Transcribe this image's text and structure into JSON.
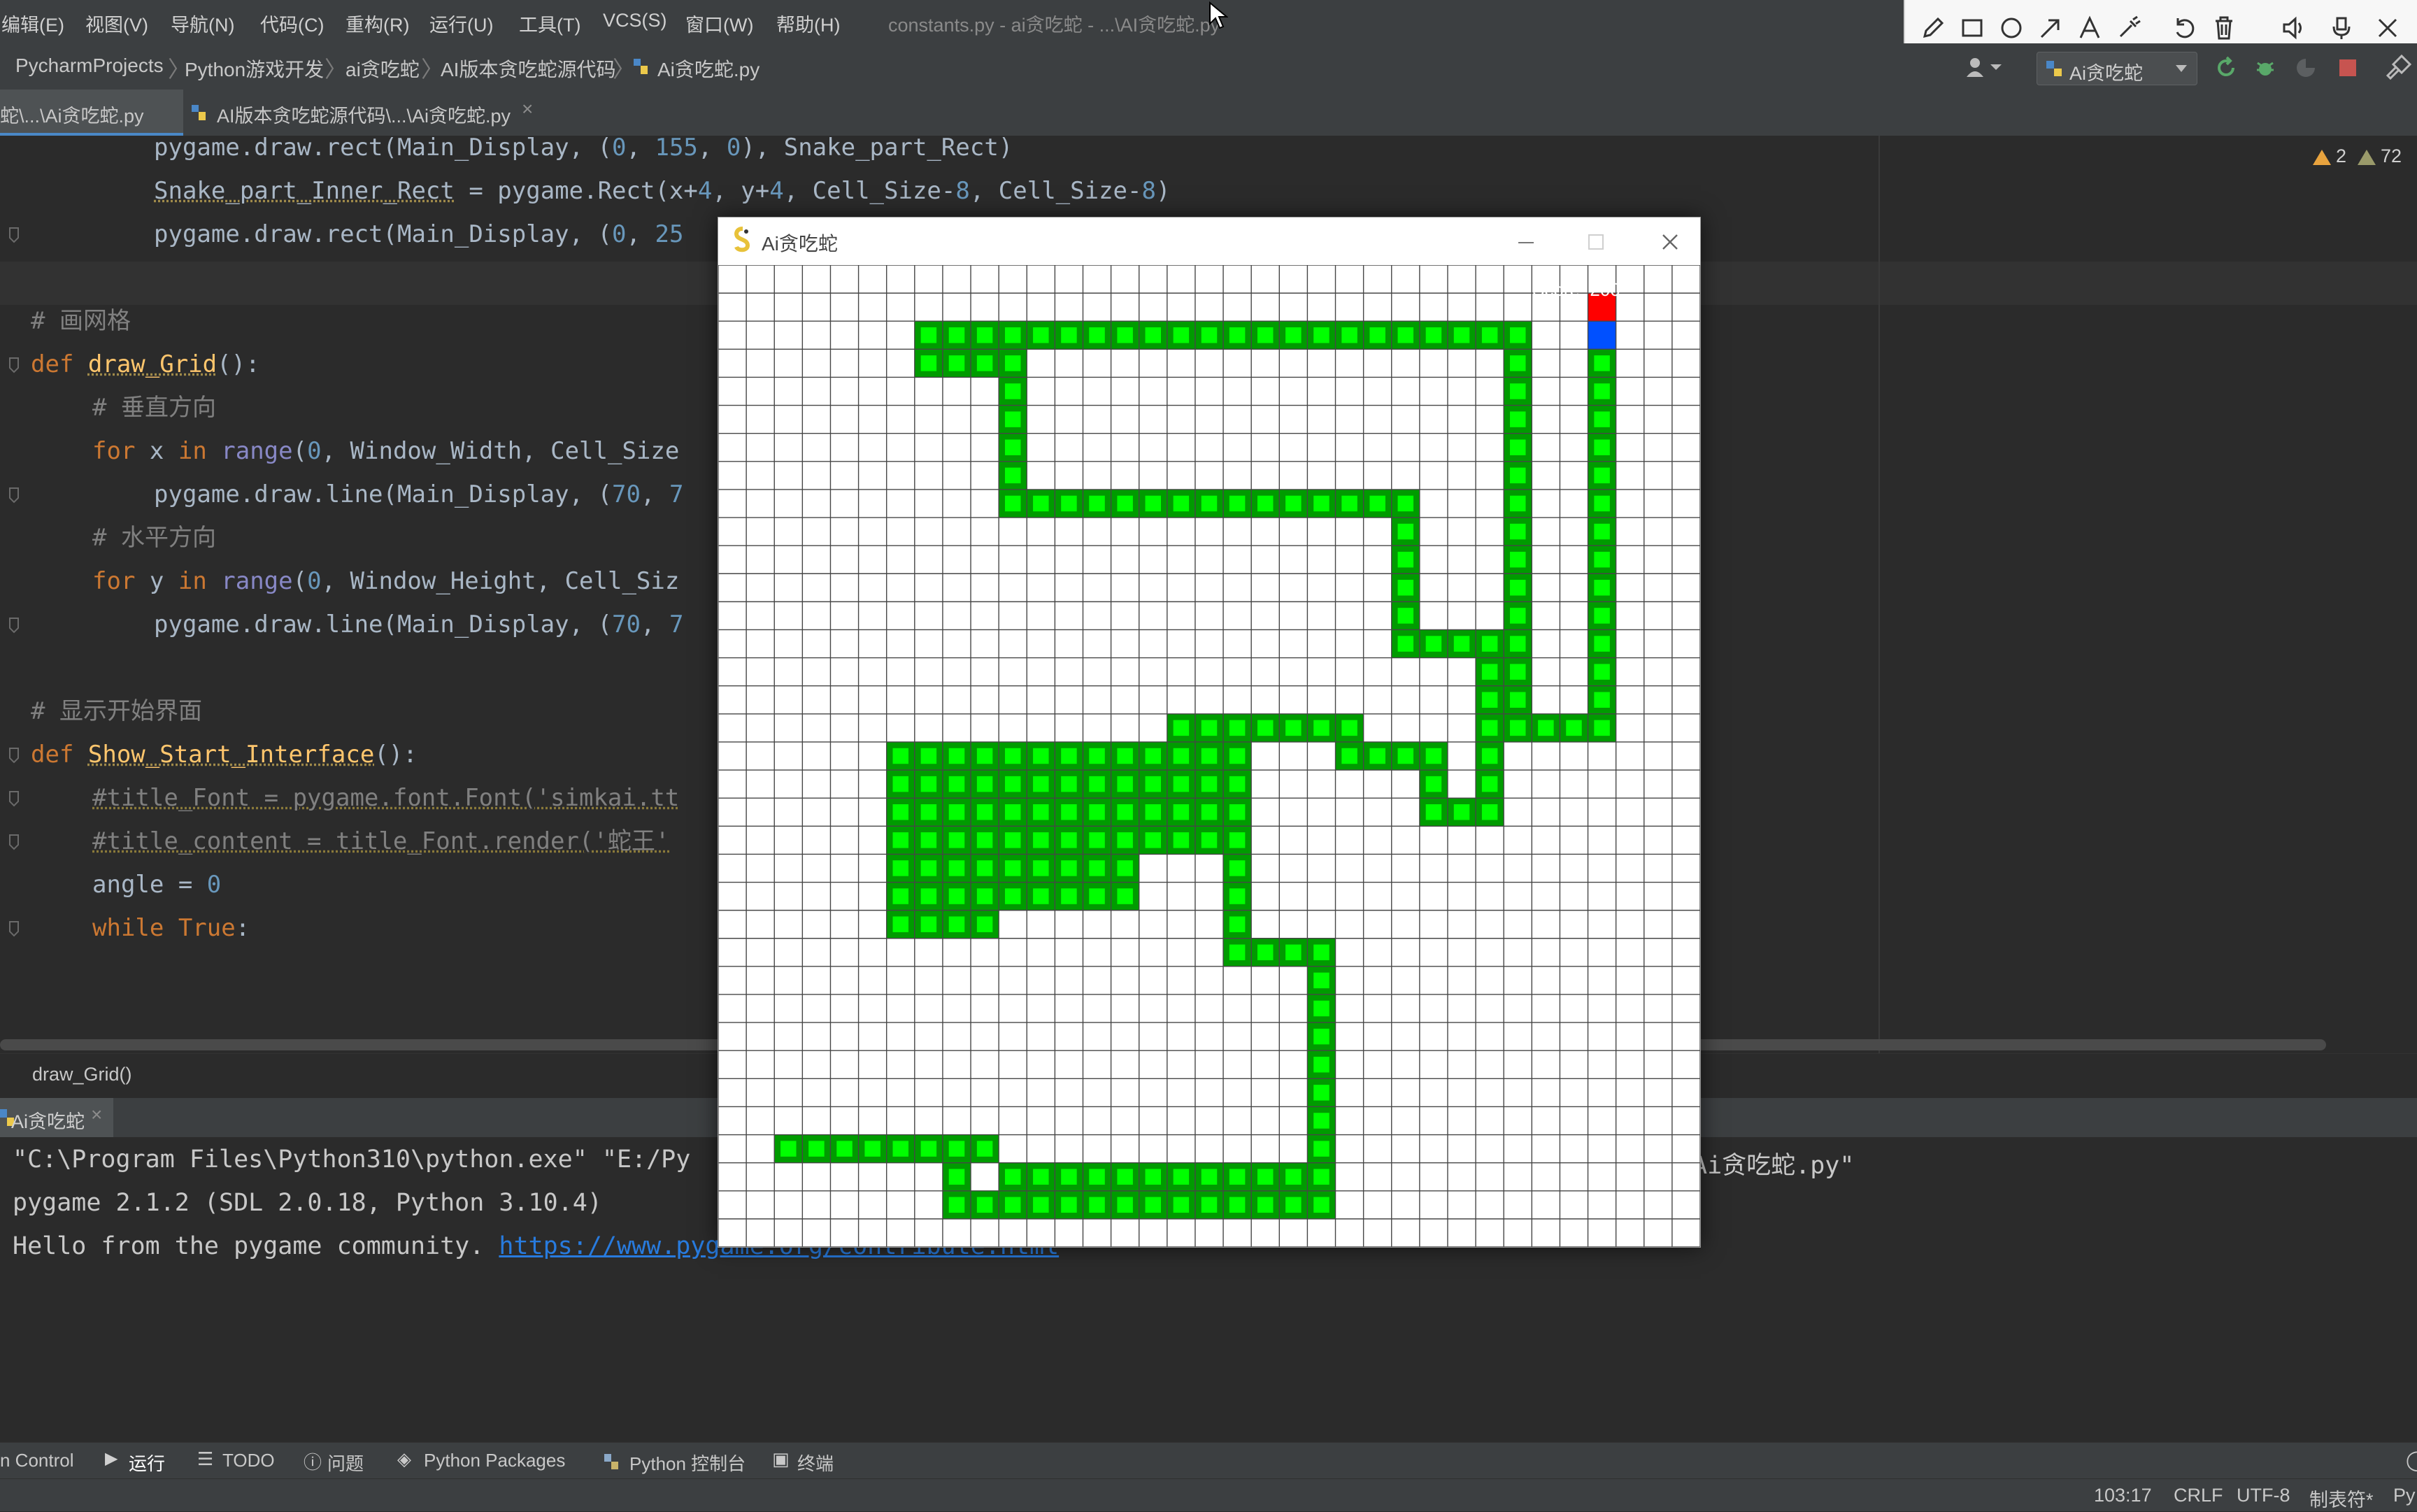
{
  "menubar": {
    "items": [
      "编辑(E)",
      "视图(V)",
      "导航(N)",
      "代码(C)",
      "重构(R)",
      "运行(U)",
      "工具(T)",
      "VCS(S)",
      "窗口(W)",
      "帮助(H)"
    ],
    "window_title": "constants.py - ai贪吃蛇 - ...\\AI贪吃蛇.py"
  },
  "navbar": {
    "crumbs": [
      "PycharmProjects",
      "Python游戏开发",
      "ai贪吃蛇",
      "AI版本贪吃蛇源代码",
      "Ai贪吃蛇.py"
    ],
    "run_config": "Ai贪吃蛇"
  },
  "tabs": [
    {
      "label": "蛇\\...\\Ai贪吃蛇.py",
      "active": true
    },
    {
      "label": "AI版本贪吃蛇源代码\\...\\Ai贪吃蛇.py",
      "active": false
    }
  ],
  "inspection": {
    "warnings": "2",
    "weak_warnings": "72"
  },
  "code": [
    {
      "indent": 2,
      "tokens": [
        [
          "pygame.draw.rect(Main_Display, (",
          "p"
        ],
        [
          "0",
          "n"
        ],
        [
          ", ",
          "p"
        ],
        [
          "155",
          "n"
        ],
        [
          ", ",
          "p"
        ],
        [
          "0",
          "n"
        ],
        [
          "), Snake_part_Rect)",
          "p"
        ]
      ]
    },
    {
      "indent": 2,
      "tokens": [
        [
          "Snake_part_Inner_Rect",
          "u"
        ],
        [
          " = pygame.Rect(x+",
          "p"
        ],
        [
          "4",
          "n"
        ],
        [
          ", y+",
          "p"
        ],
        [
          "4",
          "n"
        ],
        [
          ", Cell_Size-",
          "p"
        ],
        [
          "8",
          "n"
        ],
        [
          ", Cell_Size-",
          "p"
        ],
        [
          "8",
          "n"
        ],
        [
          ")",
          "p"
        ]
      ]
    },
    {
      "indent": 2,
      "tokens": [
        [
          "pygame.draw.rect(Main_Display, (",
          "p"
        ],
        [
          "0",
          "n"
        ],
        [
          ", ",
          "p"
        ],
        [
          "25",
          "n"
        ]
      ]
    },
    {
      "indent": 0,
      "tokens": []
    },
    {
      "indent": 0,
      "tokens": [
        [
          "# 画网格",
          "c"
        ]
      ]
    },
    {
      "indent": 0,
      "tokens": [
        [
          "def ",
          "k"
        ],
        [
          "draw_Grid",
          "fu"
        ],
        [
          "():",
          "p"
        ]
      ]
    },
    {
      "indent": 1,
      "tokens": [
        [
          "# 垂直方向",
          "c"
        ]
      ]
    },
    {
      "indent": 1,
      "tokens": [
        [
          "for ",
          "k"
        ],
        [
          "x ",
          "p"
        ],
        [
          "in ",
          "k"
        ],
        [
          "range",
          "b"
        ],
        [
          "(",
          "p"
        ],
        [
          "0",
          "n"
        ],
        [
          ", Window_Width, Cell_Size",
          "p"
        ]
      ]
    },
    {
      "indent": 2,
      "tokens": [
        [
          "pygame.draw.line(Main_Display, (",
          "p"
        ],
        [
          "70",
          "n"
        ],
        [
          ", ",
          "p"
        ],
        [
          "7",
          "n"
        ]
      ]
    },
    {
      "indent": 1,
      "tokens": [
        [
          "# 水平方向",
          "c"
        ]
      ]
    },
    {
      "indent": 1,
      "tokens": [
        [
          "for ",
          "k"
        ],
        [
          "y ",
          "p"
        ],
        [
          "in ",
          "k"
        ],
        [
          "range",
          "b"
        ],
        [
          "(",
          "p"
        ],
        [
          "0",
          "n"
        ],
        [
          ", Window_Height, Cell_Siz",
          "p"
        ]
      ]
    },
    {
      "indent": 2,
      "tokens": [
        [
          "pygame.draw.line(Main_Display, (",
          "p"
        ],
        [
          "70",
          "n"
        ],
        [
          ", ",
          "p"
        ],
        [
          "7",
          "n"
        ]
      ]
    },
    {
      "indent": 0,
      "tokens": []
    },
    {
      "indent": 0,
      "tokens": [
        [
          "# 显示开始界面",
          "c"
        ]
      ]
    },
    {
      "indent": 0,
      "tokens": [
        [
          "def ",
          "k"
        ],
        [
          "Show_Start_Interface",
          "fu"
        ],
        [
          "():",
          "p"
        ]
      ]
    },
    {
      "indent": 1,
      "tokens": [
        [
          "#title_Font = pygame.font.Font('simkai.tt",
          "cu"
        ]
      ]
    },
    {
      "indent": 1,
      "tokens": [
        [
          "#title_content = title_Font.render('蛇王'",
          "cu"
        ]
      ]
    },
    {
      "indent": 1,
      "tokens": [
        [
          "angle = ",
          "p"
        ],
        [
          "0",
          "n"
        ]
      ]
    },
    {
      "indent": 1,
      "tokens": [
        [
          "while ",
          "k"
        ],
        [
          "True",
          "k"
        ],
        [
          ":",
          "p"
        ]
      ]
    }
  ],
  "editor_breadcrumb": "draw_Grid()",
  "run_tab": {
    "label": "Ai贪吃蛇"
  },
  "console": {
    "line1": "\"C:\\Program Files\\Python310\\python.exe\" \"E:/Py",
    "line1_end": "Ai贪吃蛇.py\"",
    "line2": "pygame 2.1.2 (SDL 2.0.18, Python 3.10.4)",
    "line3_prefix": "Hello from the pygame community. ",
    "line3_link": "https://www.pygame.org/contribute.html"
  },
  "bottom_tools": [
    "n Control",
    "运行",
    "TODO",
    "问题",
    "Python Packages",
    "Python 控制台",
    "终端"
  ],
  "status": {
    "position": "103:17",
    "line_ending": "CRLF",
    "encoding": "UTF-8",
    "indent": "制表符*",
    "interpreter": "Py"
  },
  "game": {
    "title": "Ai贪吃蛇",
    "grid_cols": 35,
    "grid_rows": 35,
    "score_text": "Score: 200",
    "apple_cell": [
      31,
      1
    ],
    "head_cell": [
      31,
      2
    ],
    "colors": {
      "snake_outer": "#009b00",
      "snake_inner": "#00ff00",
      "apple": "#ff0000",
      "head": "#0050ff",
      "grid_line": "#464646"
    },
    "snake_cells": [
      [
        7,
        2
      ],
      [
        8,
        2
      ],
      [
        9,
        2
      ],
      [
        10,
        2
      ],
      [
        11,
        2
      ],
      [
        12,
        2
      ],
      [
        13,
        2
      ],
      [
        14,
        2
      ],
      [
        15,
        2
      ],
      [
        16,
        2
      ],
      [
        17,
        2
      ],
      [
        18,
        2
      ],
      [
        19,
        2
      ],
      [
        20,
        2
      ],
      [
        21,
        2
      ],
      [
        22,
        2
      ],
      [
        23,
        2
      ],
      [
        24,
        2
      ],
      [
        25,
        2
      ],
      [
        26,
        2
      ],
      [
        27,
        2
      ],
      [
        28,
        2
      ],
      [
        7,
        3
      ],
      [
        8,
        3
      ],
      [
        9,
        3
      ],
      [
        10,
        3
      ],
      [
        10,
        4
      ],
      [
        10,
        5
      ],
      [
        10,
        6
      ],
      [
        10,
        7
      ],
      [
        10,
        8
      ],
      [
        11,
        8
      ],
      [
        12,
        8
      ],
      [
        13,
        8
      ],
      [
        14,
        8
      ],
      [
        15,
        8
      ],
      [
        16,
        8
      ],
      [
        17,
        8
      ],
      [
        18,
        8
      ],
      [
        19,
        8
      ],
      [
        20,
        8
      ],
      [
        21,
        8
      ],
      [
        22,
        8
      ],
      [
        23,
        8
      ],
      [
        24,
        8
      ],
      [
        24,
        9
      ],
      [
        24,
        10
      ],
      [
        24,
        11
      ],
      [
        24,
        12
      ],
      [
        24,
        13
      ],
      [
        25,
        13
      ],
      [
        26,
        13
      ],
      [
        27,
        13
      ],
      [
        28,
        3
      ],
      [
        28,
        4
      ],
      [
        28,
        5
      ],
      [
        28,
        6
      ],
      [
        28,
        7
      ],
      [
        28,
        8
      ],
      [
        28,
        9
      ],
      [
        28,
        10
      ],
      [
        28,
        11
      ],
      [
        28,
        12
      ],
      [
        28,
        13
      ],
      [
        27,
        14
      ],
      [
        28,
        14
      ],
      [
        27,
        15
      ],
      [
        28,
        15
      ],
      [
        27,
        16
      ],
      [
        28,
        16
      ],
      [
        29,
        16
      ],
      [
        30,
        16
      ],
      [
        31,
        16
      ],
      [
        31,
        3
      ],
      [
        31,
        4
      ],
      [
        31,
        5
      ],
      [
        31,
        6
      ],
      [
        31,
        7
      ],
      [
        31,
        8
      ],
      [
        31,
        9
      ],
      [
        31,
        10
      ],
      [
        31,
        11
      ],
      [
        31,
        12
      ],
      [
        31,
        13
      ],
      [
        31,
        14
      ],
      [
        31,
        15
      ],
      [
        27,
        17
      ],
      [
        27,
        18
      ],
      [
        27,
        19
      ],
      [
        26,
        19
      ],
      [
        25,
        19
      ],
      [
        25,
        18
      ],
      [
        25,
        17
      ],
      [
        22,
        17
      ],
      [
        23,
        17
      ],
      [
        24,
        17
      ],
      [
        16,
        16
      ],
      [
        17,
        16
      ],
      [
        18,
        16
      ],
      [
        19,
        16
      ],
      [
        20,
        16
      ],
      [
        21,
        16
      ],
      [
        22,
        16
      ],
      [
        6,
        17
      ],
      [
        7,
        17
      ],
      [
        8,
        17
      ],
      [
        9,
        17
      ],
      [
        10,
        17
      ],
      [
        11,
        17
      ],
      [
        12,
        17
      ],
      [
        13,
        17
      ],
      [
        14,
        17
      ],
      [
        15,
        17
      ],
      [
        16,
        17
      ],
      [
        17,
        17
      ],
      [
        18,
        17
      ],
      [
        6,
        18
      ],
      [
        7,
        18
      ],
      [
        8,
        18
      ],
      [
        9,
        18
      ],
      [
        10,
        18
      ],
      [
        11,
        18
      ],
      [
        12,
        18
      ],
      [
        13,
        18
      ],
      [
        14,
        18
      ],
      [
        15,
        18
      ],
      [
        16,
        18
      ],
      [
        17,
        18
      ],
      [
        18,
        18
      ],
      [
        6,
        19
      ],
      [
        7,
        19
      ],
      [
        8,
        19
      ],
      [
        9,
        19
      ],
      [
        10,
        19
      ],
      [
        11,
        19
      ],
      [
        12,
        19
      ],
      [
        13,
        19
      ],
      [
        14,
        19
      ],
      [
        15,
        19
      ],
      [
        16,
        19
      ],
      [
        17,
        19
      ],
      [
        18,
        19
      ],
      [
        6,
        20
      ],
      [
        7,
        20
      ],
      [
        8,
        20
      ],
      [
        9,
        20
      ],
      [
        10,
        20
      ],
      [
        11,
        20
      ],
      [
        12,
        20
      ],
      [
        13,
        20
      ],
      [
        14,
        20
      ],
      [
        15,
        20
      ],
      [
        16,
        20
      ],
      [
        17,
        20
      ],
      [
        18,
        20
      ],
      [
        6,
        21
      ],
      [
        7,
        21
      ],
      [
        8,
        21
      ],
      [
        9,
        21
      ],
      [
        10,
        21
      ],
      [
        11,
        21
      ],
      [
        12,
        21
      ],
      [
        13,
        21
      ],
      [
        14,
        21
      ],
      [
        18,
        21
      ],
      [
        6,
        22
      ],
      [
        7,
        22
      ],
      [
        8,
        22
      ],
      [
        9,
        22
      ],
      [
        10,
        22
      ],
      [
        11,
        22
      ],
      [
        12,
        22
      ],
      [
        13,
        22
      ],
      [
        14,
        22
      ],
      [
        18,
        22
      ],
      [
        6,
        23
      ],
      [
        7,
        23
      ],
      [
        8,
        23
      ],
      [
        9,
        23
      ],
      [
        18,
        23
      ],
      [
        18,
        24
      ],
      [
        19,
        24
      ],
      [
        20,
        24
      ],
      [
        21,
        24
      ],
      [
        21,
        25
      ],
      [
        21,
        26
      ],
      [
        21,
        27
      ],
      [
        21,
        28
      ],
      [
        21,
        29
      ],
      [
        21,
        30
      ],
      [
        21,
        31
      ],
      [
        21,
        32
      ],
      [
        8,
        31
      ],
      [
        9,
        31
      ],
      [
        10,
        32
      ],
      [
        11,
        32
      ],
      [
        12,
        32
      ],
      [
        13,
        32
      ],
      [
        14,
        32
      ],
      [
        15,
        32
      ],
      [
        16,
        32
      ],
      [
        17,
        32
      ],
      [
        18,
        32
      ],
      [
        19,
        32
      ],
      [
        20,
        32
      ],
      [
        2,
        31
      ],
      [
        3,
        31
      ],
      [
        4,
        31
      ],
      [
        5,
        31
      ],
      [
        6,
        31
      ],
      [
        7,
        31
      ],
      [
        8,
        32
      ],
      [
        8,
        33
      ],
      [
        9,
        33
      ],
      [
        10,
        33
      ],
      [
        11,
        33
      ],
      [
        12,
        33
      ],
      [
        13,
        33
      ],
      [
        14,
        33
      ],
      [
        15,
        33
      ],
      [
        16,
        33
      ],
      [
        17,
        33
      ],
      [
        18,
        33
      ],
      [
        19,
        33
      ],
      [
        20,
        33
      ],
      [
        21,
        33
      ]
    ]
  }
}
